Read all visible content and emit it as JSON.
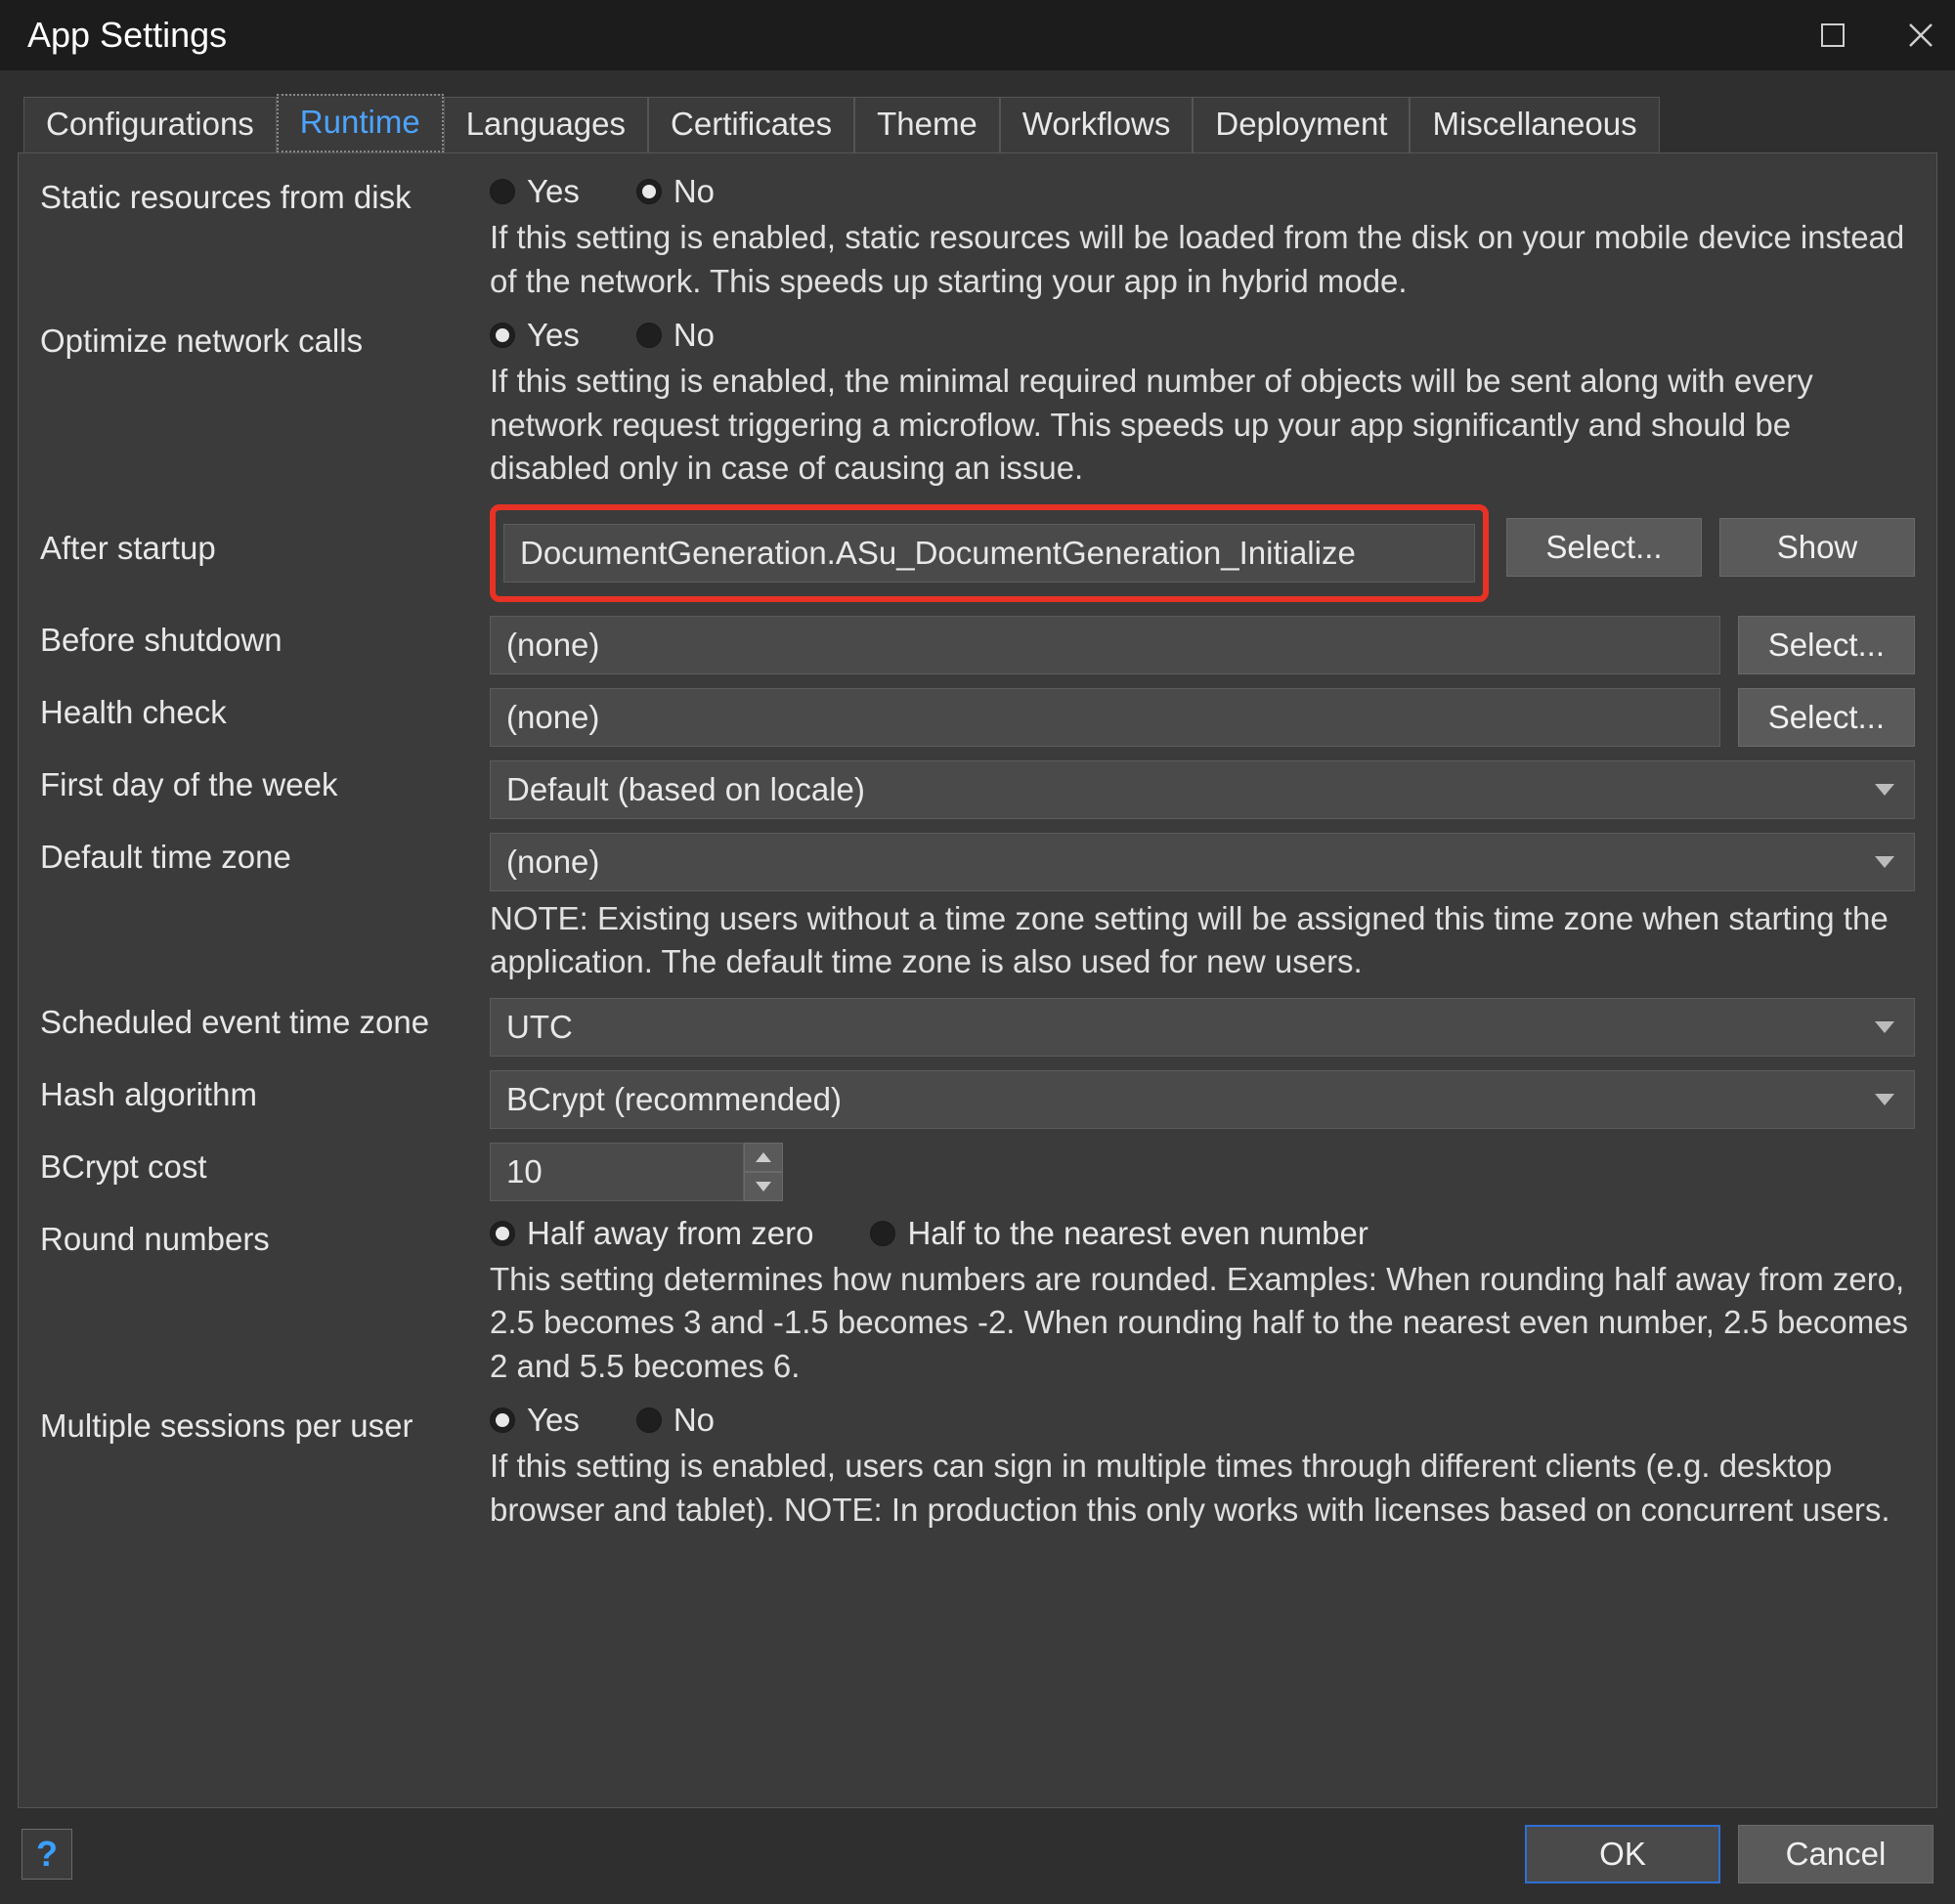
{
  "window": {
    "title": "App Settings"
  },
  "tabs": [
    "Configurations",
    "Runtime",
    "Languages",
    "Certificates",
    "Theme",
    "Workflows",
    "Deployment",
    "Miscellaneous"
  ],
  "activeTabIndex": 1,
  "fields": {
    "staticResources": {
      "label": "Static resources from disk",
      "yes": "Yes",
      "no": "No",
      "selected": "No",
      "desc": "If this setting is enabled, static resources will be loaded from the disk on your mobile device instead of the network. This speeds up starting your app in hybrid mode."
    },
    "optimizeNetwork": {
      "label": "Optimize network calls",
      "yes": "Yes",
      "no": "No",
      "selected": "Yes",
      "desc": "If this setting is enabled, the minimal required number of objects will be sent along with every network request triggering a microflow. This speeds up your app significantly and should be disabled only in case of causing an issue."
    },
    "afterStartup": {
      "label": "After startup",
      "value": "DocumentGeneration.ASu_DocumentGeneration_Initialize",
      "select": "Select...",
      "show": "Show"
    },
    "beforeShutdown": {
      "label": "Before shutdown",
      "value": "(none)",
      "select": "Select..."
    },
    "healthCheck": {
      "label": "Health check",
      "value": "(none)",
      "select": "Select..."
    },
    "firstDay": {
      "label": "First day of the week",
      "value": "Default (based on locale)"
    },
    "defaultTz": {
      "label": "Default time zone",
      "value": "(none)",
      "note": "NOTE: Existing users without a time zone setting will be assigned this time zone when starting the application. The default time zone is also used for new users."
    },
    "schedTz": {
      "label": "Scheduled event time zone",
      "value": "UTC"
    },
    "hashAlgo": {
      "label": "Hash algorithm",
      "value": "BCrypt (recommended)"
    },
    "bcryptCost": {
      "label": "BCrypt cost",
      "value": "10"
    },
    "roundNumbers": {
      "label": "Round numbers",
      "optA": "Half away from zero",
      "optB": "Half to the nearest even number",
      "selected": "A",
      "desc": "This setting determines how numbers are rounded. Examples: When rounding half away from zero, 2.5 becomes 3 and -1.5 becomes -2. When rounding half to the nearest even number, 2.5 becomes 2 and 5.5 becomes 6."
    },
    "multiSessions": {
      "label": "Multiple sessions per user",
      "yes": "Yes",
      "no": "No",
      "selected": "Yes",
      "desc": "If this setting is enabled, users can sign in multiple times through different clients (e.g. desktop browser and tablet). NOTE: In production this only works with licenses based on concurrent users."
    }
  },
  "footer": {
    "help": "?",
    "ok": "OK",
    "cancel": "Cancel"
  }
}
